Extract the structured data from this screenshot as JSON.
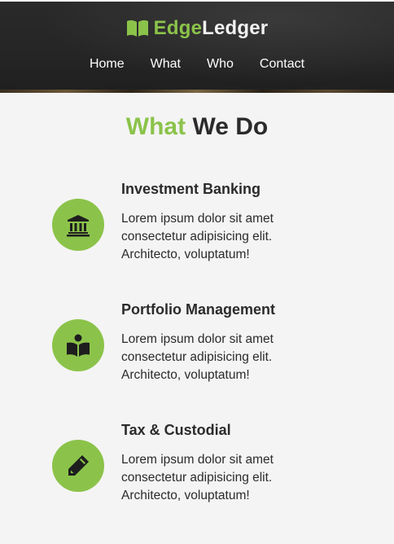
{
  "brand": {
    "part1": "Edge",
    "part2": "Ledger",
    "icon": "book-icon",
    "accent": "#8bc34a"
  },
  "nav": [
    "Home",
    "What",
    "Who",
    "Contact"
  ],
  "section": {
    "title_accent": "What",
    "title_rest": "We Do"
  },
  "services": [
    {
      "title": "Investment Banking",
      "text": "Lorem ipsum dolor sit amet consectetur adipisicing elit. Architecto, voluptatum!",
      "icon": "bank-icon"
    },
    {
      "title": "Portfolio Management",
      "text": "Lorem ipsum dolor sit amet consectetur adipisicing elit. Architecto, voluptatum!",
      "icon": "reader-icon"
    },
    {
      "title": "Tax & Custodial",
      "text": "Lorem ipsum dolor sit amet consectetur adipisicing elit. Architecto, voluptatum!",
      "icon": "pencil-icon"
    }
  ]
}
